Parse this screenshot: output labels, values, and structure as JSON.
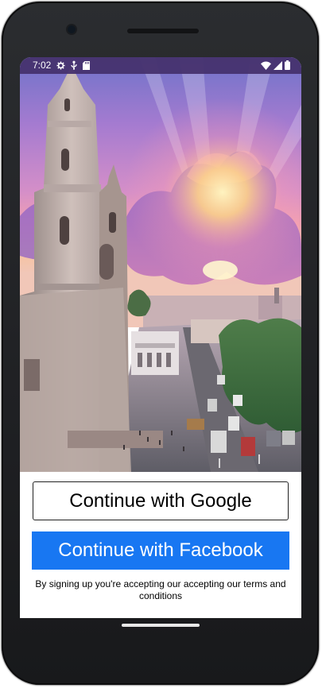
{
  "status_bar": {
    "time": "7:02"
  },
  "hero": {
    "icon": "city-cathedral-sunset-photo"
  },
  "auth": {
    "google_label": "Continue with Google",
    "facebook_label": "Continue with Facebook",
    "terms_text": "By signing up you're accepting our accepting our terms and conditions"
  },
  "colors": {
    "facebook_blue": "#1877f2",
    "statusbar_bg": "#46326e"
  }
}
